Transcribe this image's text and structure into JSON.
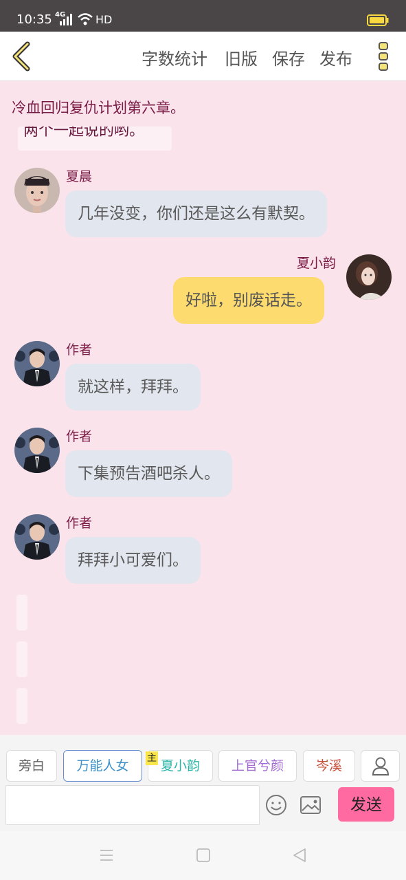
{
  "status": {
    "time": "10:35",
    "network": "4G",
    "hd": "HD"
  },
  "toolbar": {
    "word_count": "字数统计",
    "old_version": "旧版",
    "save": "保存",
    "publish": "发布"
  },
  "chapter_title": "冷血回归复仇计划第六章。",
  "partial_message": "两个一起说的哟。",
  "messages": [
    {
      "sender": "夏晨",
      "text": "几年没变，你们还是这么有默契。",
      "side": "left"
    },
    {
      "sender": "夏小韵",
      "text": "好啦，别废话走。",
      "side": "right"
    },
    {
      "sender": "作者",
      "text": "就这样，拜拜。",
      "side": "left"
    },
    {
      "sender": "作者",
      "text": "下集预告酒吧杀人。",
      "side": "left"
    },
    {
      "sender": "作者",
      "text": "拜拜小可爱们。",
      "side": "left"
    }
  ],
  "roles": [
    {
      "label": "旁白",
      "color": "#666666"
    },
    {
      "label": "万能人女",
      "color": "#3a8fc9"
    },
    {
      "label": "夏小韵",
      "color": "#2bb5a8"
    },
    {
      "label": "上官兮颜",
      "color": "#a36cd4"
    },
    {
      "label": "岑溪",
      "color": "#c9503a"
    }
  ],
  "main_badge": "主",
  "input": {
    "value": "",
    "placeholder": ""
  },
  "send_label": "发送"
}
